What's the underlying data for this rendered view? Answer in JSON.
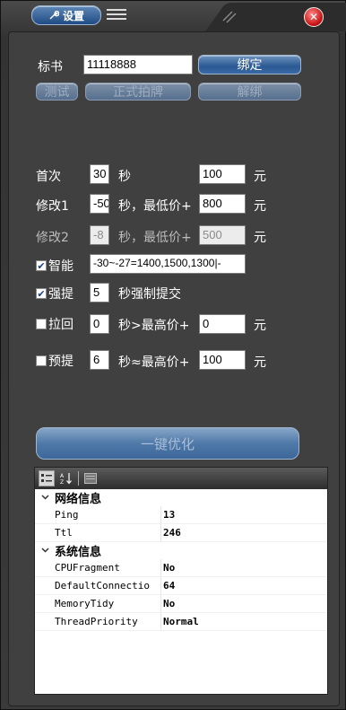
{
  "titlebar": {
    "settings_label": "设置",
    "settings_icon": "wrench-icon",
    "menu_icon": "hamburger-icon",
    "close_icon": "close-icon",
    "close_glyph": "✕",
    "accent_color": "#2a5993",
    "close_color": "#c81414"
  },
  "bid": {
    "label": "标书",
    "value": "11118888",
    "bind_button": "绑定",
    "test_button": "测试",
    "formal_button": "正式拍牌",
    "unbind_button": "解绑"
  },
  "first": {
    "label": "首次",
    "seconds": "30",
    "seconds_unit": "秒",
    "price": "100",
    "price_unit": "元"
  },
  "modify1": {
    "label": "修改1",
    "seconds": "-50",
    "text": "秒，最低价+",
    "price": "800",
    "price_unit": "元"
  },
  "modify2": {
    "label": "修改2",
    "seconds": "-8",
    "text": "秒，最低价+",
    "price": "500",
    "price_unit": "元"
  },
  "smart": {
    "label": "智能",
    "checked": true,
    "check_glyph": "✔",
    "formula": "-30~-27=1400,1500,1300|-"
  },
  "force": {
    "label": "强提",
    "checked": true,
    "check_glyph": "✔",
    "seconds": "5",
    "text": "秒强制提交"
  },
  "pullback": {
    "label": "拉回",
    "checked": false,
    "seconds": "0",
    "text": "秒>最高价+",
    "price": "0",
    "price_unit": "元"
  },
  "preset": {
    "label": "预提",
    "checked": false,
    "seconds": "6",
    "text": "秒≈最高价+",
    "price": "100",
    "price_unit": "元"
  },
  "optimize_button": "一键优化",
  "property_grid": {
    "toolbar_icons": [
      "categorized-icon",
      "alphabetical-icon",
      "property-pages-icon"
    ],
    "categories": [
      {
        "name": "网络信息",
        "expanded": true,
        "rows": [
          {
            "key": "Ping",
            "value": "13"
          },
          {
            "key": "Ttl",
            "value": "246"
          }
        ]
      },
      {
        "name": "系统信息",
        "expanded": true,
        "rows": [
          {
            "key": "CPUFragment",
            "value": "No"
          },
          {
            "key": "DefaultConnectio",
            "value": "64"
          },
          {
            "key": "MemoryTidy",
            "value": "No"
          },
          {
            "key": "ThreadPriority",
            "value": "Normal"
          }
        ]
      }
    ]
  }
}
